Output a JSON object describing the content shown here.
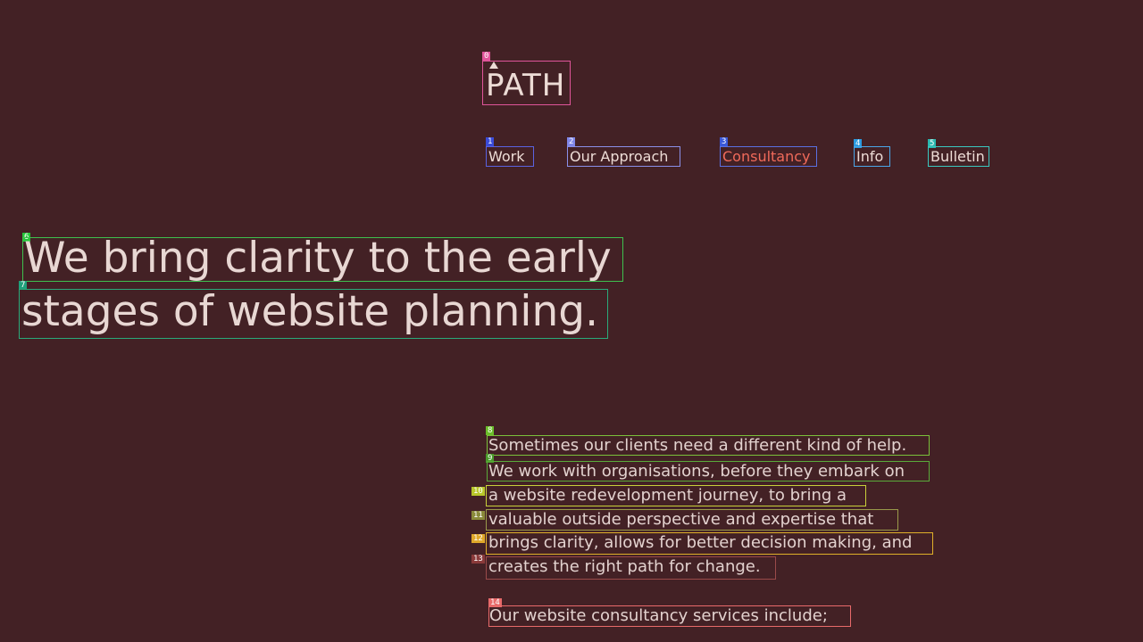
{
  "colors": {
    "background": "#432125",
    "text": "#eddcd6",
    "active_nav": "#f06a5a"
  },
  "logo": {
    "text": "PATH",
    "icon": "caret-up-icon"
  },
  "nav": {
    "items": [
      {
        "label": "Work",
        "active": false
      },
      {
        "label": "Our Approach",
        "active": false
      },
      {
        "label": "Consultancy",
        "active": true
      },
      {
        "label": "Info",
        "active": false
      },
      {
        "label": "Bulletin",
        "active": false
      }
    ]
  },
  "hero": {
    "lines": [
      "We bring clarity to the early",
      "stages of website planning."
    ]
  },
  "intro": {
    "lines": [
      "Sometimes our clients need a different kind of help.",
      "We work with organisations, before they embark on",
      "a website redevelopment journey, to bring a",
      "valuable outside perspective and expertise that",
      "brings clarity, allows for better decision making, and",
      "creates the right path for change."
    ]
  },
  "services": {
    "intro": "Our website consultancy services include;"
  },
  "badges": [
    "0",
    "1",
    "2",
    "3",
    "4",
    "5",
    "6",
    "7",
    "8",
    "9",
    "10",
    "11",
    "12",
    "13",
    "14"
  ]
}
